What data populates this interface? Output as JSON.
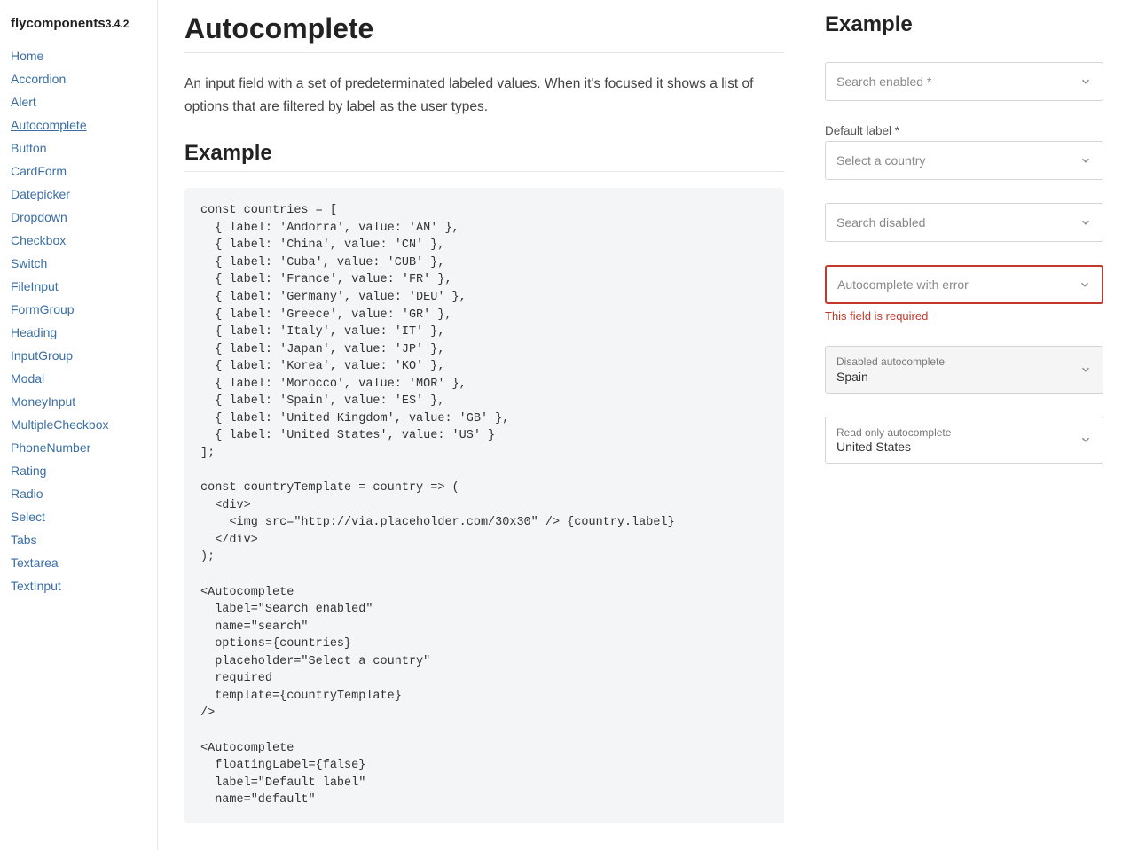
{
  "brand": {
    "name": "flycomponents",
    "version": "3.4.2"
  },
  "sidebar": {
    "items": [
      {
        "label": "Home",
        "active": false
      },
      {
        "label": "Accordion",
        "active": false
      },
      {
        "label": "Alert",
        "active": false
      },
      {
        "label": "Autocomplete",
        "active": true
      },
      {
        "label": "Button",
        "active": false
      },
      {
        "label": "CardForm",
        "active": false
      },
      {
        "label": "Datepicker",
        "active": false
      },
      {
        "label": "Dropdown",
        "active": false
      },
      {
        "label": "Checkbox",
        "active": false
      },
      {
        "label": "Switch",
        "active": false
      },
      {
        "label": "FileInput",
        "active": false
      },
      {
        "label": "FormGroup",
        "active": false
      },
      {
        "label": "Heading",
        "active": false
      },
      {
        "label": "InputGroup",
        "active": false
      },
      {
        "label": "Modal",
        "active": false
      },
      {
        "label": "MoneyInput",
        "active": false
      },
      {
        "label": "MultipleCheckbox",
        "active": false
      },
      {
        "label": "PhoneNumber",
        "active": false
      },
      {
        "label": "Rating",
        "active": false
      },
      {
        "label": "Radio",
        "active": false
      },
      {
        "label": "Select",
        "active": false
      },
      {
        "label": "Tabs",
        "active": false
      },
      {
        "label": "Textarea",
        "active": false
      },
      {
        "label": "TextInput",
        "active": false
      }
    ]
  },
  "main": {
    "title": "Autocomplete",
    "description": "An input field with a set of predeterminated labeled values. When it's focused it shows a list of options that are filtered by label as the user types.",
    "example_heading": "Example",
    "code": "const countries = [\n  { label: 'Andorra', value: 'AN' },\n  { label: 'China', value: 'CN' },\n  { label: 'Cuba', value: 'CUB' },\n  { label: 'France', value: 'FR' },\n  { label: 'Germany', value: 'DEU' },\n  { label: 'Greece', value: 'GR' },\n  { label: 'Italy', value: 'IT' },\n  { label: 'Japan', value: 'JP' },\n  { label: 'Korea', value: 'KO' },\n  { label: 'Morocco', value: 'MOR' },\n  { label: 'Spain', value: 'ES' },\n  { label: 'United Kingdom', value: 'GB' },\n  { label: 'United States', value: 'US' }\n];\n\nconst countryTemplate = country => (\n  <div>\n    <img src=\"http://via.placeholder.com/30x30\" /> {country.label}\n  </div>\n);\n\n<Autocomplete\n  label=\"Search enabled\"\n  name=\"search\"\n  options={countries}\n  placeholder=\"Select a country\"\n  required\n  template={countryTemplate}\n/>\n\n<Autocomplete\n  floatingLabel={false}\n  label=\"Default label\"\n  name=\"default\""
  },
  "example": {
    "title": "Example",
    "fields": {
      "search_enabled": {
        "placeholder": "Search enabled *"
      },
      "default_label": {
        "label": "Default label *",
        "placeholder": "Select a country"
      },
      "search_disabled": {
        "placeholder": "Search disabled"
      },
      "with_error": {
        "placeholder": "Autocomplete with error",
        "error": "This field is required"
      },
      "disabled": {
        "label": "Disabled autocomplete",
        "value": "Spain"
      },
      "readonly": {
        "label": "Read only autocomplete",
        "value": "United States"
      }
    }
  }
}
